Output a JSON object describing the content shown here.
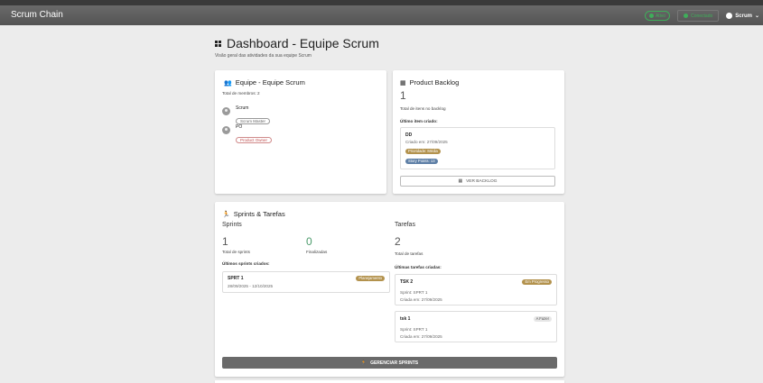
{
  "app": {
    "title": "Scrum Chain",
    "status_chip": "Ativo",
    "connect_label": "Conectado",
    "user_label": "Scrum"
  },
  "page": {
    "title": "Dashboard - Equipe Scrum",
    "subtitle": "Visão geral das atividades da sua equipe Scrum"
  },
  "team": {
    "title": "Equipe - Equipe Scrum",
    "members_total": "Total de membros: 2",
    "members": [
      {
        "name": "Scrum",
        "role": "Scrum Master"
      },
      {
        "name": "PO",
        "role": "Product Owner"
      }
    ]
  },
  "backlog": {
    "title": "Product Backlog",
    "count": "1",
    "count_label": "Total de itens no backlog",
    "last_item_label": "Último item criado:",
    "last_item": {
      "name": "DD",
      "created": "Criado em: 27/09/2025",
      "priority": "Prioridade: Média",
      "story_points": "Story Points: 13"
    },
    "view_button": "VER BACKLOG"
  },
  "sprints_card": {
    "title": "Sprints & Tarefas",
    "sprints": {
      "heading": "Sprints",
      "total": "1",
      "total_label": "Total de sprints",
      "finished": "0",
      "finished_label": "Finalizadas",
      "last_label": "Últimos sprints criados:",
      "items": [
        {
          "name": "SPRT 1",
          "dates": "28/09/2025 - 12/10/2025",
          "status": "Planejamento"
        }
      ]
    },
    "tasks": {
      "heading": "Tarefas",
      "total": "2",
      "total_label": "Total de tarefas",
      "last_label": "Últimas tarefas criadas:",
      "items": [
        {
          "name": "TSK 2",
          "status": "Em Progresso",
          "sprint": "Sprint: SPRT 1",
          "created": "Criada em: 27/09/2025"
        },
        {
          "name": "tsk 1",
          "status": "A Fazer",
          "sprint": "Sprint: SPRT 1",
          "created": "Criada em: 27/09/2025"
        }
      ]
    },
    "manage_button": "GERENCIAR SPRINTS"
  }
}
